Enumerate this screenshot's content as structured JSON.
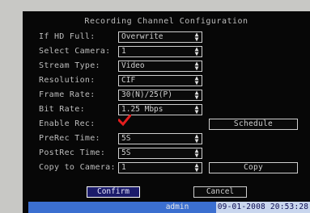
{
  "title": "Recording Channel Configuration",
  "rows": [
    {
      "label": "If HD Full:",
      "value": "Overwrite"
    },
    {
      "label": "Select Camera:",
      "value": "1"
    },
    {
      "label": "Stream Type:",
      "value": "Video"
    },
    {
      "label": "Resolution:",
      "value": "CIF"
    },
    {
      "label": "Frame Rate:",
      "value": "30(N)/25(P)"
    },
    {
      "label": "Bit Rate:",
      "value": "1.25 Mbps"
    },
    {
      "label": "Enable Rec:",
      "checked": true
    },
    {
      "label": "PreRec Time:",
      "value": "5S"
    },
    {
      "label": "PostRec Time:",
      "value": "5S"
    },
    {
      "label": "Copy to Camera:",
      "value": "1"
    }
  ],
  "buttons": {
    "schedule": "Schedule",
    "copy": "Copy",
    "confirm": "Confirm",
    "cancel": "Cancel"
  },
  "status": {
    "user": "admin",
    "datetime": "09-01-2008 20:53:28"
  },
  "colors": {
    "checkmark": "#e31e1e",
    "confirm_bg": "#1b1b6a",
    "statusbar": "#3b6fd0"
  },
  "icons": {
    "spinner": "up-down-arrow-icon",
    "enable": "checkmark-icon"
  }
}
